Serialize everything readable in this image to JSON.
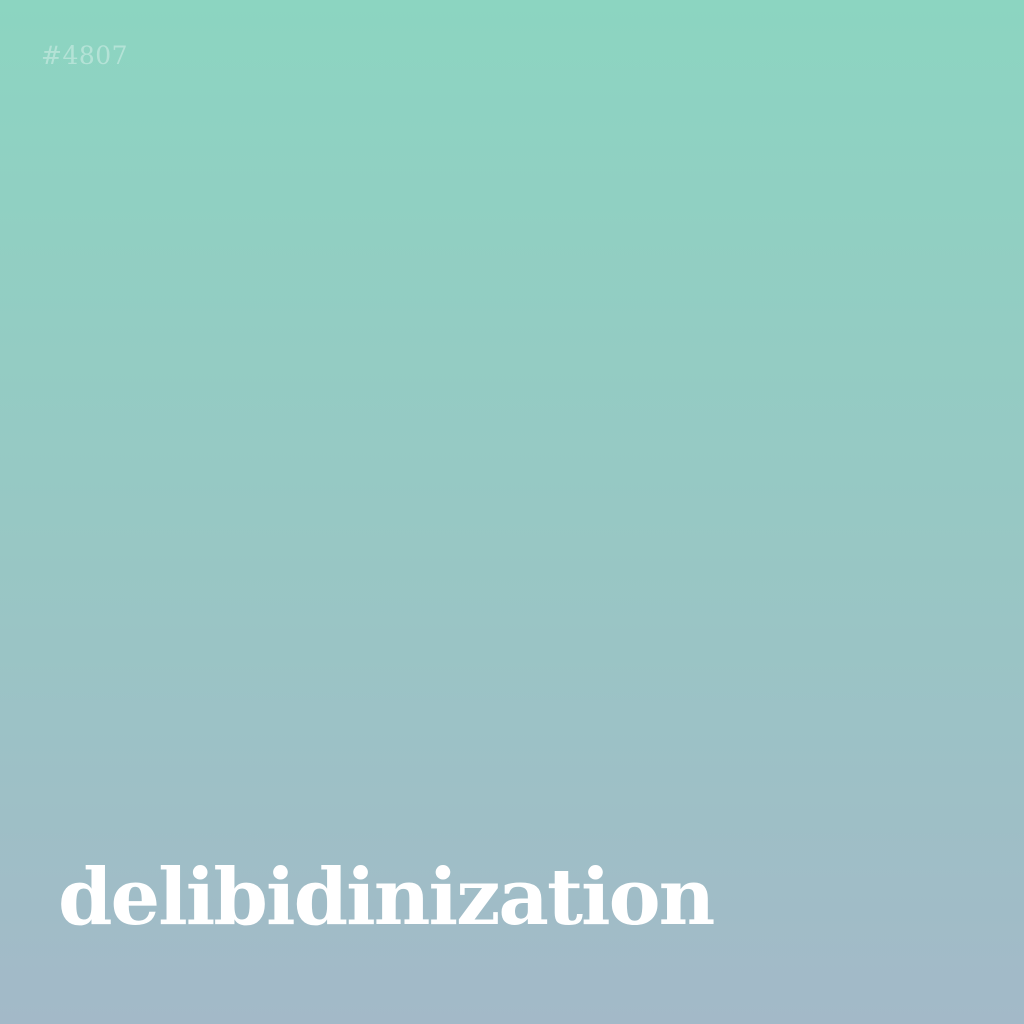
{
  "card": {
    "number": "#4807",
    "word": "delibidinization"
  },
  "colors": {
    "gradient_top": "#8cd5c1",
    "gradient_middle": "#97c8c4",
    "gradient_bottom": "#a3b9c8",
    "text": "#ffffff"
  }
}
